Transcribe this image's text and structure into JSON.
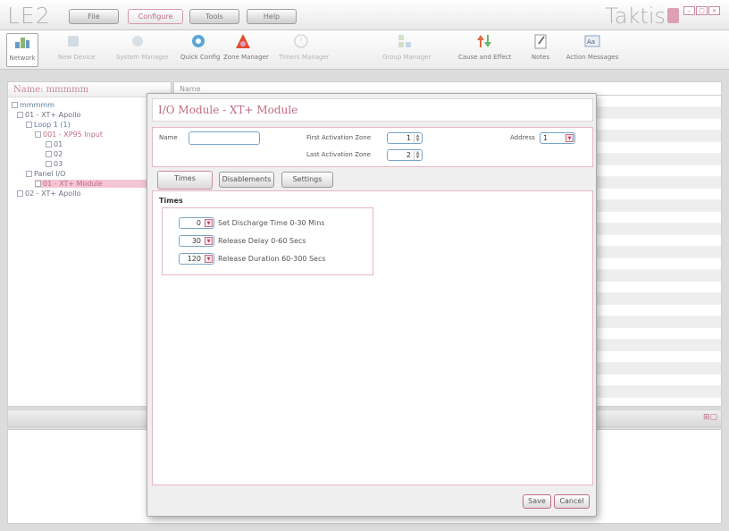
{
  "app": {
    "logo": "LE2",
    "brand": "Taktis"
  },
  "menu": [
    "File",
    "Configure",
    "Tools",
    "Help"
  ],
  "toolbar": [
    {
      "label": "Network",
      "icon": "network-icon"
    },
    {
      "label": "New Device",
      "icon": "new-device-icon"
    },
    {
      "label": "System Manager",
      "icon": "system-manager-icon"
    },
    {
      "label": "Quick Config",
      "icon": "quick-config-icon"
    },
    {
      "label": "Zone Manager",
      "icon": "zone-manager-icon"
    },
    {
      "label": "Timers Manager",
      "icon": "timers-manager-icon"
    },
    {
      "label": "Group Manager",
      "icon": "group-manager-icon"
    },
    {
      "label": "Cause and Effect",
      "icon": "cause-effect-icon"
    },
    {
      "label": "Notes",
      "icon": "notes-icon"
    },
    {
      "label": "Action Messages",
      "icon": "action-messages-icon"
    }
  ],
  "left": {
    "header": "Name: mmmmm",
    "tree": [
      {
        "text": "mmmmm"
      },
      {
        "text": "01 - XT+ Apollo"
      },
      {
        "text": "Loop 1 (1)"
      },
      {
        "text": "001 - XP95 Input"
      },
      {
        "text": "01"
      },
      {
        "text": "02"
      },
      {
        "text": "03"
      },
      {
        "text": "Panel I/O"
      },
      {
        "text": "01 - XT+ Module"
      },
      {
        "text": "02 - XT+ Apollo"
      }
    ]
  },
  "grid": {
    "header": "Name"
  },
  "dialog": {
    "title": "I/O Module - XT+ Module",
    "name_label": "Name",
    "name_value": "",
    "first_zone_label": "First Activation Zone",
    "first_zone_value": "1",
    "last_zone_label": "Last Activation Zone",
    "last_zone_value": "2",
    "address_label": "Address",
    "address_value": "1",
    "tabs": [
      "Times",
      "Disablements",
      "Settings"
    ],
    "times_heading": "Times",
    "times": [
      {
        "value": "0",
        "label": "Set Discharge Time 0-30 Mins"
      },
      {
        "value": "30",
        "label": "Release Delay 0-60 Secs"
      },
      {
        "value": "120",
        "label": "Release Duration 60-300 Secs"
      }
    ],
    "save": "Save",
    "cancel": "Cancel"
  },
  "colors": {
    "accent": "#c06d82",
    "border_pink": "#e5b7c5",
    "input_border": "#7aa3c9"
  }
}
